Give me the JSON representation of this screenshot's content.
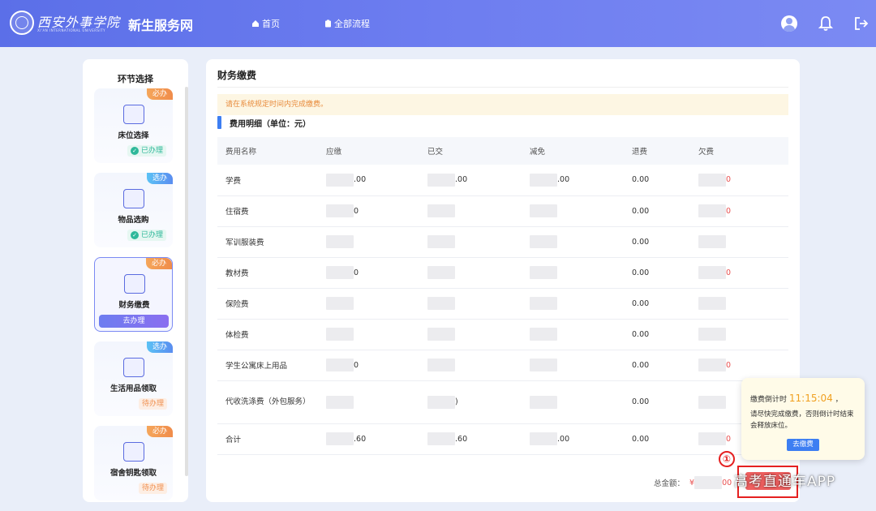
{
  "header": {
    "school_name": "西安外事学院",
    "school_subtitle": "XI'AN INTERNATIONAL UNIVERSITY",
    "site_title": "新生服务网",
    "nav": [
      {
        "label": "首页",
        "icon": "home-icon"
      },
      {
        "label": "全部流程",
        "icon": "clipboard-icon"
      }
    ],
    "icons": [
      "user-avatar-icon",
      "bell-icon",
      "logout-icon"
    ]
  },
  "sidebar": {
    "title": "环节选择",
    "steps": [
      {
        "label": "床位选择",
        "tag": "必办",
        "status": "已办理",
        "icon": "bed-icon"
      },
      {
        "label": "物品选购",
        "tag": "选办",
        "status": "已办理",
        "icon": "boxes-icon"
      },
      {
        "label": "财务缴费",
        "tag": "必办",
        "status": "去办理",
        "icon": "payment-doc-icon",
        "active": true
      },
      {
        "label": "生活用品领取",
        "tag": "选办",
        "status": "待办理",
        "icon": "basket-icon"
      },
      {
        "label": "宿舍钥匙领取",
        "tag": "必办",
        "status": "待办理",
        "icon": "key-icon"
      }
    ]
  },
  "main": {
    "title": "财务缴费",
    "notice": "请在系统规定时间内完成缴费。",
    "section_title": "费用明细（单位：元）",
    "table": {
      "headers": [
        "费用名称",
        "应缴",
        "已交",
        "减免",
        "退费",
        "欠费"
      ],
      "rows": [
        {
          "name": "学费",
          "due": ".00",
          "paid": ".00",
          "waived": ".00",
          "refund": "0.00",
          "owed": "0"
        },
        {
          "name": "住宿费",
          "due": "0",
          "paid": "",
          "waived": "",
          "refund": "0.00",
          "owed": "0"
        },
        {
          "name": "军训服装费",
          "due": "",
          "paid": "",
          "waived": "",
          "refund": "0.00",
          "owed": ""
        },
        {
          "name": "教材费",
          "due": "0",
          "paid": "",
          "waived": "",
          "refund": "0.00",
          "owed": "0"
        },
        {
          "name": "保险费",
          "due": "",
          "paid": "",
          "waived": "",
          "refund": "0.00",
          "owed": ""
        },
        {
          "name": "体检费",
          "due": "",
          "paid": "",
          "waived": "",
          "refund": "0.00",
          "owed": ""
        },
        {
          "name": "学生公寓床上用品",
          "due": "0",
          "paid": "",
          "waived": "",
          "refund": "0.00",
          "owed": "0"
        },
        {
          "name": "代收洗涤费（外包服务）",
          "due": "",
          "paid": ")",
          "waived": "",
          "refund": "0.00",
          "owed": ""
        },
        {
          "name": "合计",
          "due": ".60",
          "paid": ".60",
          "waived": ".00",
          "refund": "0.00",
          "owed": "0"
        }
      ]
    },
    "total_label": "总金额：",
    "total_prefix": "¥",
    "total_suffix": "00"
  },
  "popup": {
    "countdown_label": "缴费倒计时",
    "countdown_time": "11:15:04",
    "countdown_suffix": "，",
    "message": "请尽快完成缴费，否则倒计时结束会释放床位。",
    "button": "去缴费"
  },
  "annotation": {
    "marker": "①"
  },
  "watermark": "高考直通车APP",
  "colors": {
    "header_gradient_start": "#5b6fe8",
    "accent_blue": "#3d7ef2",
    "owed_red": "#e85050",
    "required_tag": "#f08c4a",
    "optional_tag": "#5a8df0",
    "done_green": "#2eb89a",
    "highlight_red": "#e52020"
  }
}
